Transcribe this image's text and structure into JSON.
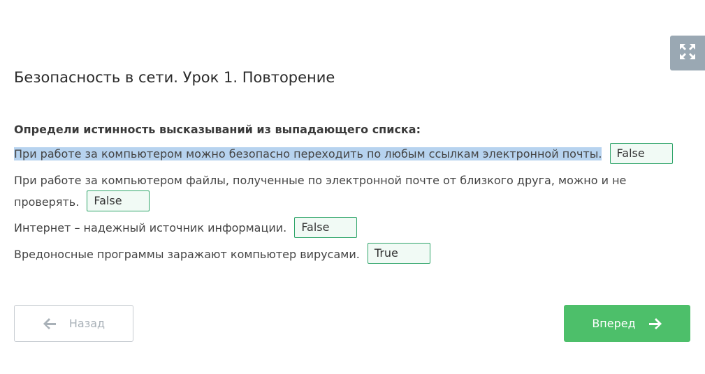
{
  "header": {
    "title": "Безопасность в сети. Урок 1. Повторение",
    "expand_icon": "expand-arrows-icon"
  },
  "task": {
    "instruction": "Определи истинность высказываний из выпадающего списка:",
    "statements": [
      {
        "text": "При работе за компьютером можно безопасно переходить по любым ссылкам электронной почты.",
        "value": "False"
      },
      {
        "text": "При работе за компьютером файлы, полученные по электронной почте от близкого друга, можно и не проверять.",
        "value": "False"
      },
      {
        "text": "Интернет – надежный источник информации.",
        "value": "False"
      },
      {
        "text": "Вредоносные программы заражают компьютер вирусами.",
        "value": "True"
      }
    ]
  },
  "nav": {
    "back_label": "Назад",
    "next_label": "Вперед",
    "back_icon": "arrow-left-icon",
    "next_icon": "arrow-right-icon"
  },
  "colors": {
    "accent_green": "#4dbf6a",
    "select_border": "#2fa56a",
    "selection_highlight": "#b7d3ef",
    "expand_button": "#9aa8b3"
  }
}
